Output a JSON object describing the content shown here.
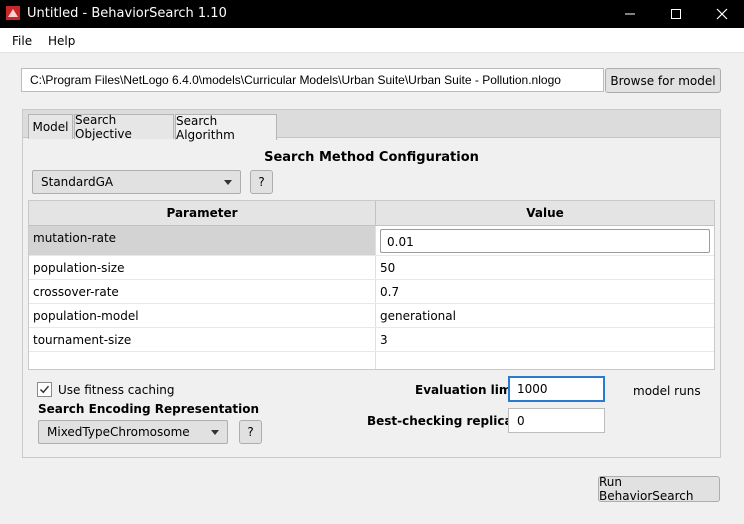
{
  "window": {
    "title": "Untitled - BehaviorSearch 1.10"
  },
  "menu": {
    "file": "File",
    "help": "Help"
  },
  "model_path": "C:\\Program Files\\NetLogo 6.4.0\\models\\Curricular Models\\Urban Suite\\Urban Suite - Pollution.nlogo",
  "browse_label": "Browse for model",
  "tabs": [
    {
      "label": "Model"
    },
    {
      "label": "Search Objective"
    },
    {
      "label": "Search Algorithm",
      "selected": true
    }
  ],
  "config": {
    "title": "Search Method Configuration",
    "method": "StandardGA",
    "help": "?"
  },
  "table": {
    "headers": {
      "parameter": "Parameter",
      "value": "Value"
    },
    "rows": [
      {
        "parameter": "mutation-rate",
        "value": "0.01"
      },
      {
        "parameter": "population-size",
        "value": "50"
      },
      {
        "parameter": "crossover-rate",
        "value": "0.7"
      },
      {
        "parameter": "population-model",
        "value": "generational"
      },
      {
        "parameter": "tournament-size",
        "value": "3"
      }
    ]
  },
  "options": {
    "caching_label": "Use fitness caching",
    "caching_checked": true,
    "encoding_label": "Search Encoding Representation",
    "encoding": "MixedTypeChromosome",
    "help": "?",
    "eval_limit_label": "Evaluation limit:",
    "eval_limit": "1000",
    "eval_unit": "model runs",
    "replicates_label": "Best-checking replicates:",
    "replicates": "0"
  },
  "run_label": "Run BehaviorSearch",
  "colors": {
    "titlebar": "#000000",
    "focus": "#2a7ad2",
    "selected_row": "#d3d3d3"
  }
}
